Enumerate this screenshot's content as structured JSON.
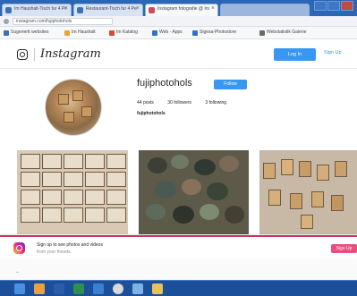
{
  "browser": {
    "tabs": [
      {
        "label": "Im Haushalt-Tisch fur 4 Pe",
        "color": "#3b6fb6",
        "active": false
      },
      {
        "label": "Restaurant-Tisch fur 4 Pe",
        "color": "#3b6fb6",
        "active": false
      },
      {
        "label": "Instagram fotografie @ Inst",
        "color": "#d1495b",
        "active": true
      },
      {
        "label": "",
        "color": "#9bb7de",
        "active": false
      }
    ],
    "url": "instagram.com/fujiphotohols",
    "bookmarks": [
      {
        "label": "Sugeriertt websites",
        "color": "#3b6fb6"
      },
      {
        "label": "Im Haushalt",
        "color": "#f0a22e"
      },
      {
        "label": "Im Katalog",
        "color": "#e0472f"
      },
      {
        "label": "Web - Apps",
        "color": "#2f6fcf"
      },
      {
        "label": "Sigesa-Photostore",
        "color": "#2f6fcf"
      },
      {
        "label": "Webstatistik Galerie",
        "color": "#6a6a6a"
      }
    ]
  },
  "instagram": {
    "wordmark": "Instagram",
    "login_label": "Log In",
    "signup_label": "Sign Up",
    "profile": {
      "username": "fujiphotohols",
      "follow_label": "Follow",
      "posts": "44 posts",
      "followers": "30 followers",
      "following": "3 following",
      "full_name": "fujiphotohols"
    },
    "banner": {
      "line1": "Sign up to see photos and videos",
      "line2": "from your friends.",
      "button_label": "Sign Up"
    }
  },
  "colors": {
    "accent": "#3897f0",
    "banner_accent": "#c9355a",
    "taskbar": "#1c4f9a"
  },
  "taskbar": {
    "icons": [
      "start-icon",
      "explorer-icon",
      "word-icon",
      "excel-icon",
      "outlook-icon",
      "chrome-icon",
      "photos-icon",
      "folder-icon"
    ]
  }
}
